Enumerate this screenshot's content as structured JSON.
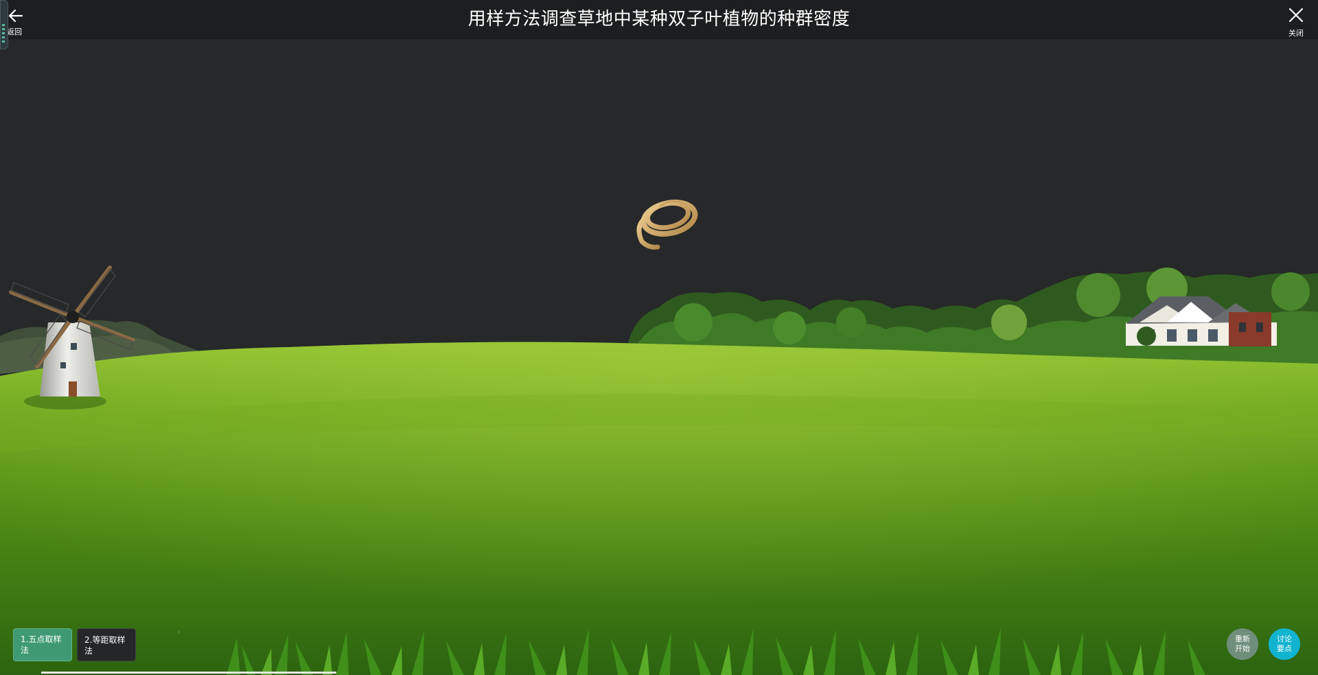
{
  "header": {
    "title": "用样方法调查草地中某种双子叶植物的种群密度",
    "back_label": "返回",
    "close_label": "关闭"
  },
  "controls": {
    "method_1_label": "1.五点取样法",
    "method_2_label": "2.等距取样法",
    "restart_label_line1": "重新",
    "restart_label_line2": "开始",
    "discuss_label_line1": "讨论",
    "discuss_label_line2": "要点"
  },
  "colors": {
    "background": "#262829",
    "header": "#1d1e1f",
    "method_active": "#3f9a74",
    "restart": "#6f8e7c",
    "discuss": "#11b3cf",
    "grass": "#5f9a1c"
  },
  "icons": {
    "back": "arrow-left-icon",
    "close": "close-icon",
    "rope": "rope-coil-icon",
    "windmill": "windmill-icon",
    "house": "house-icon"
  }
}
